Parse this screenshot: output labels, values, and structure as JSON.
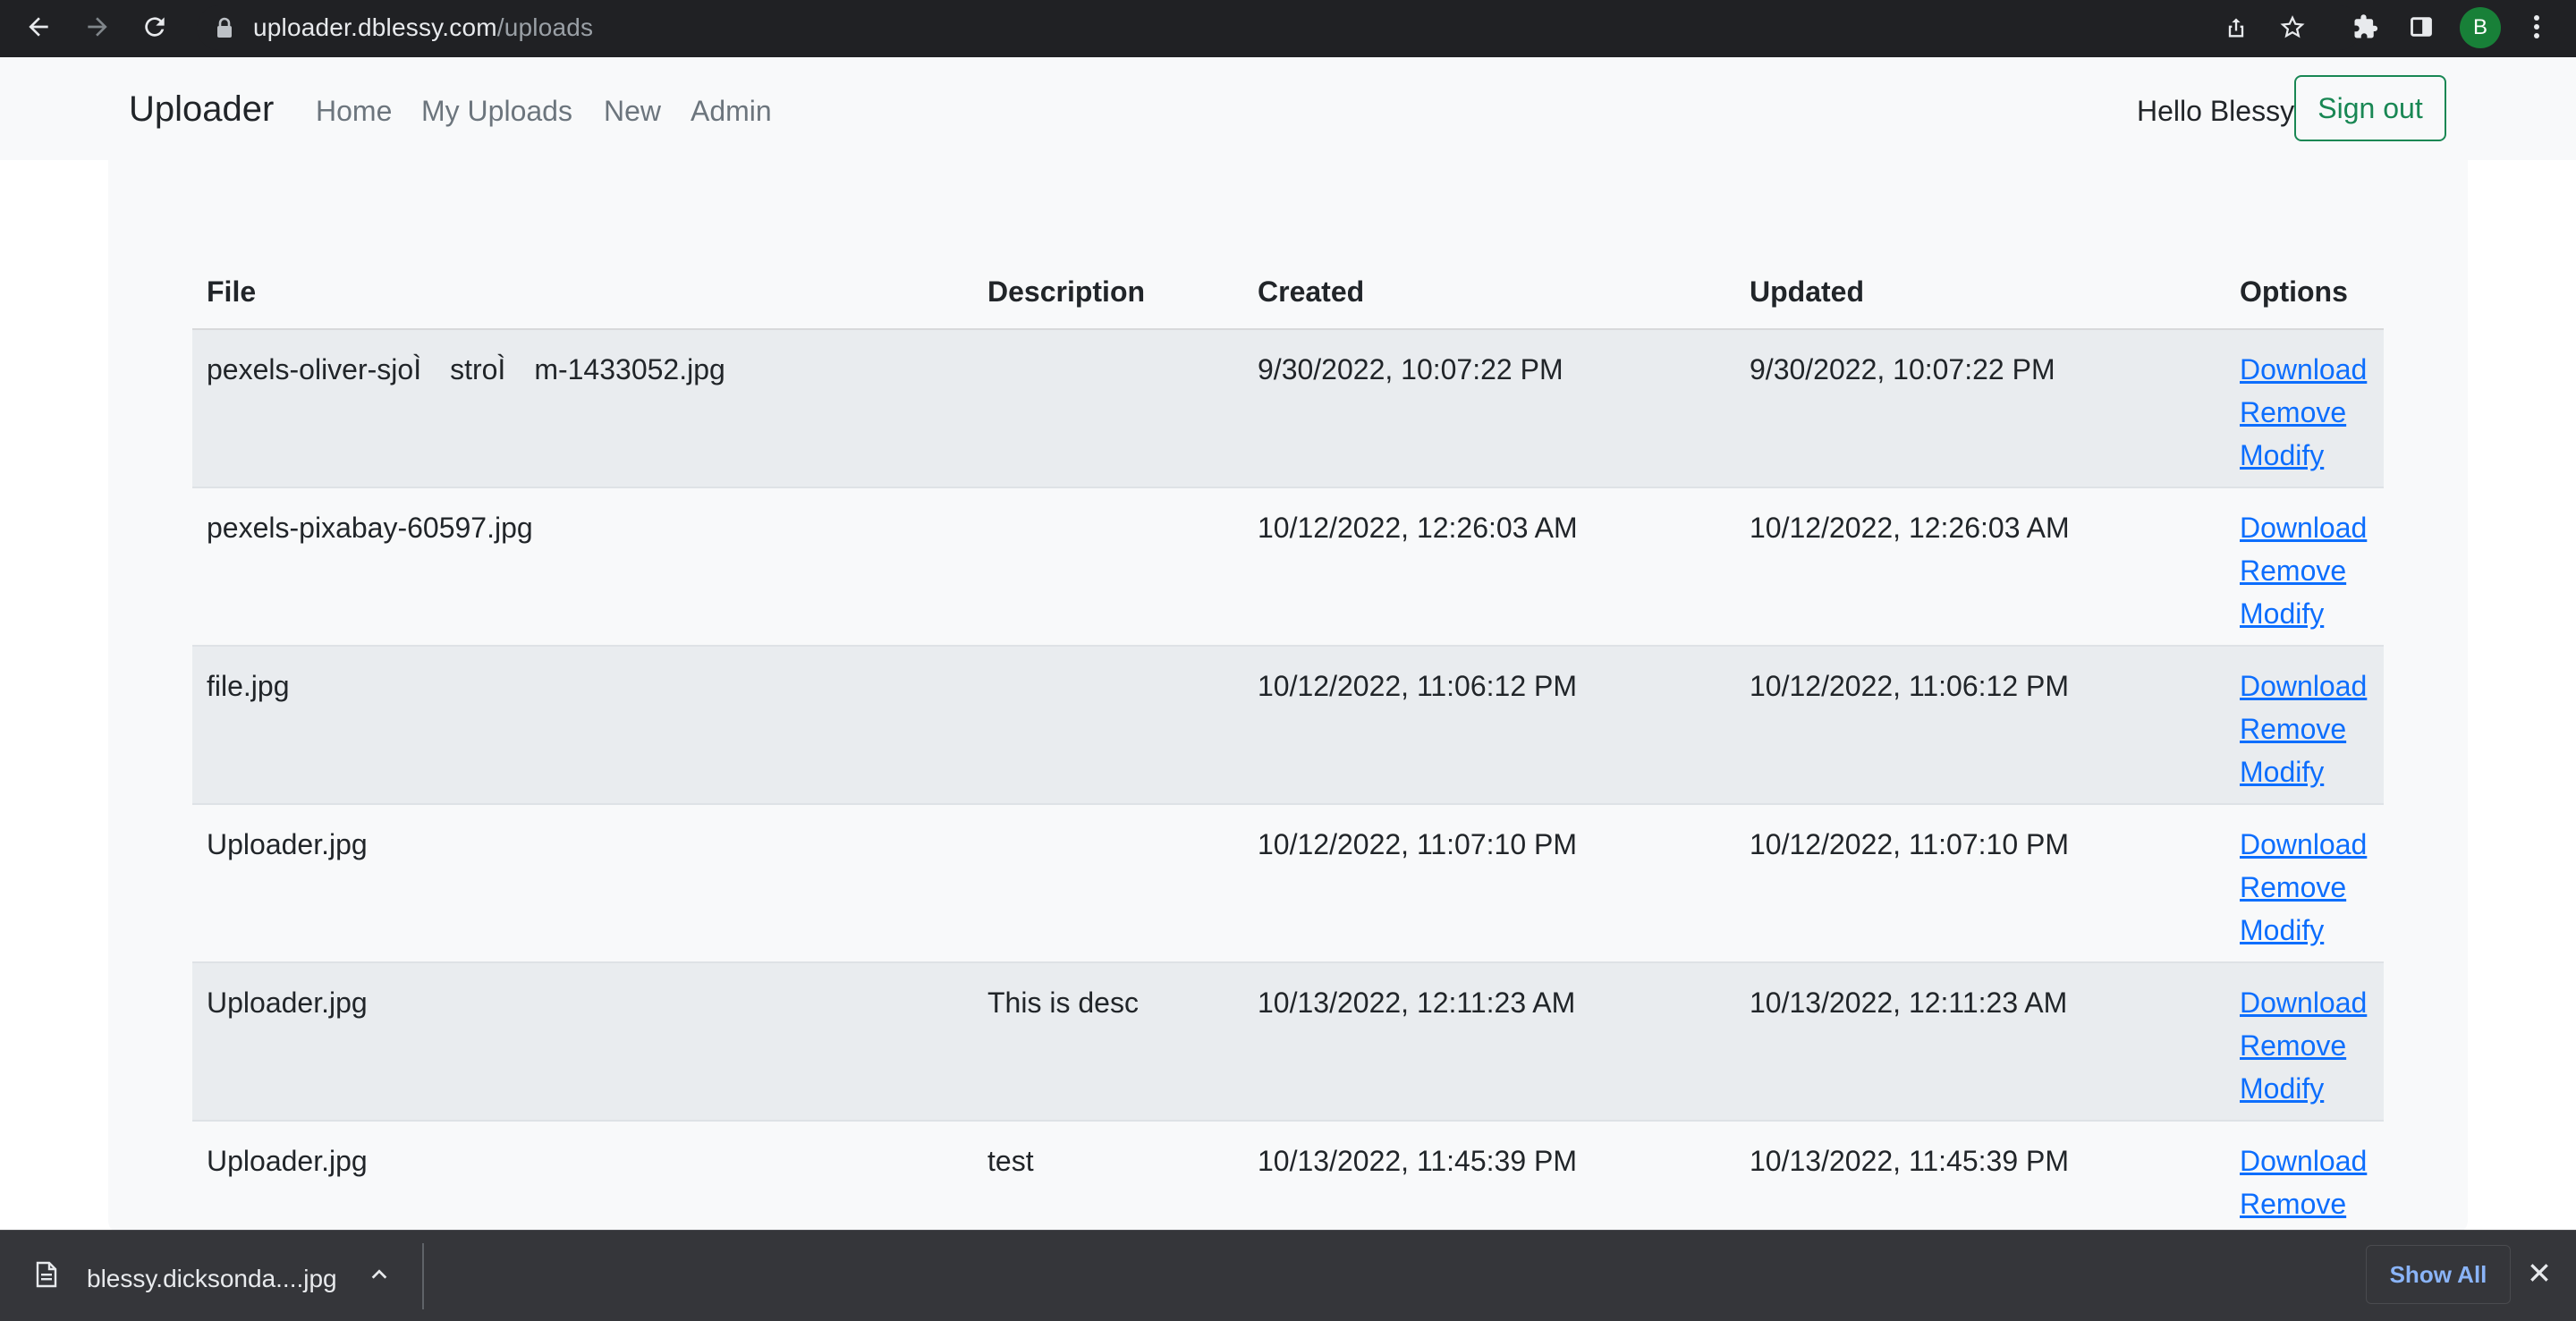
{
  "browser": {
    "url_host": "uploader.dblessy.com",
    "url_path": "/uploads",
    "profile_initial": "B"
  },
  "navbar": {
    "brand": "Uploader",
    "links": [
      "Home",
      "My Uploads",
      "New",
      "Admin"
    ],
    "greeting": "Hello Blessy",
    "signout_label": "Sign out"
  },
  "table": {
    "headers": {
      "file": "File",
      "description": "Description",
      "created": "Created",
      "updated": "Updated",
      "options": "Options"
    },
    "rows": [
      {
        "file": "pexels-oliver-sjoÌ stroÌ m-1433052.jpg",
        "description": "",
        "created": "9/30/2022, 10:07:22 PM",
        "updated": "9/30/2022, 10:07:22 PM"
      },
      {
        "file": "pexels-pixabay-60597.jpg",
        "description": "",
        "created": "10/12/2022, 12:26:03 AM",
        "updated": "10/12/2022, 12:26:03 AM"
      },
      {
        "file": "file.jpg",
        "description": "",
        "created": "10/12/2022, 11:06:12 PM",
        "updated": "10/12/2022, 11:06:12 PM"
      },
      {
        "file": "Uploader.jpg",
        "description": "",
        "created": "10/12/2022, 11:07:10 PM",
        "updated": "10/12/2022, 11:07:10 PM"
      },
      {
        "file": "Uploader.jpg",
        "description": "This is desc",
        "created": "10/13/2022, 12:11:23 AM",
        "updated": "10/13/2022, 12:11:23 AM"
      },
      {
        "file": "Uploader.jpg",
        "description": "test",
        "created": "10/13/2022, 11:45:39 PM",
        "updated": "10/13/2022, 11:45:39 PM"
      }
    ],
    "options": {
      "download": "Download",
      "remove": "Remove",
      "modify": "Modify"
    }
  },
  "download_shelf": {
    "file_name": "blessy.dicksonda....jpg",
    "show_all_label": "Show All"
  },
  "colors": {
    "link": "#0d6efd",
    "signout": "#198754",
    "navbar_bg": "#f8f9fa",
    "striped_row": "#e9ecef",
    "chrome_bg": "#202124",
    "shelf_bg": "#35363a"
  }
}
